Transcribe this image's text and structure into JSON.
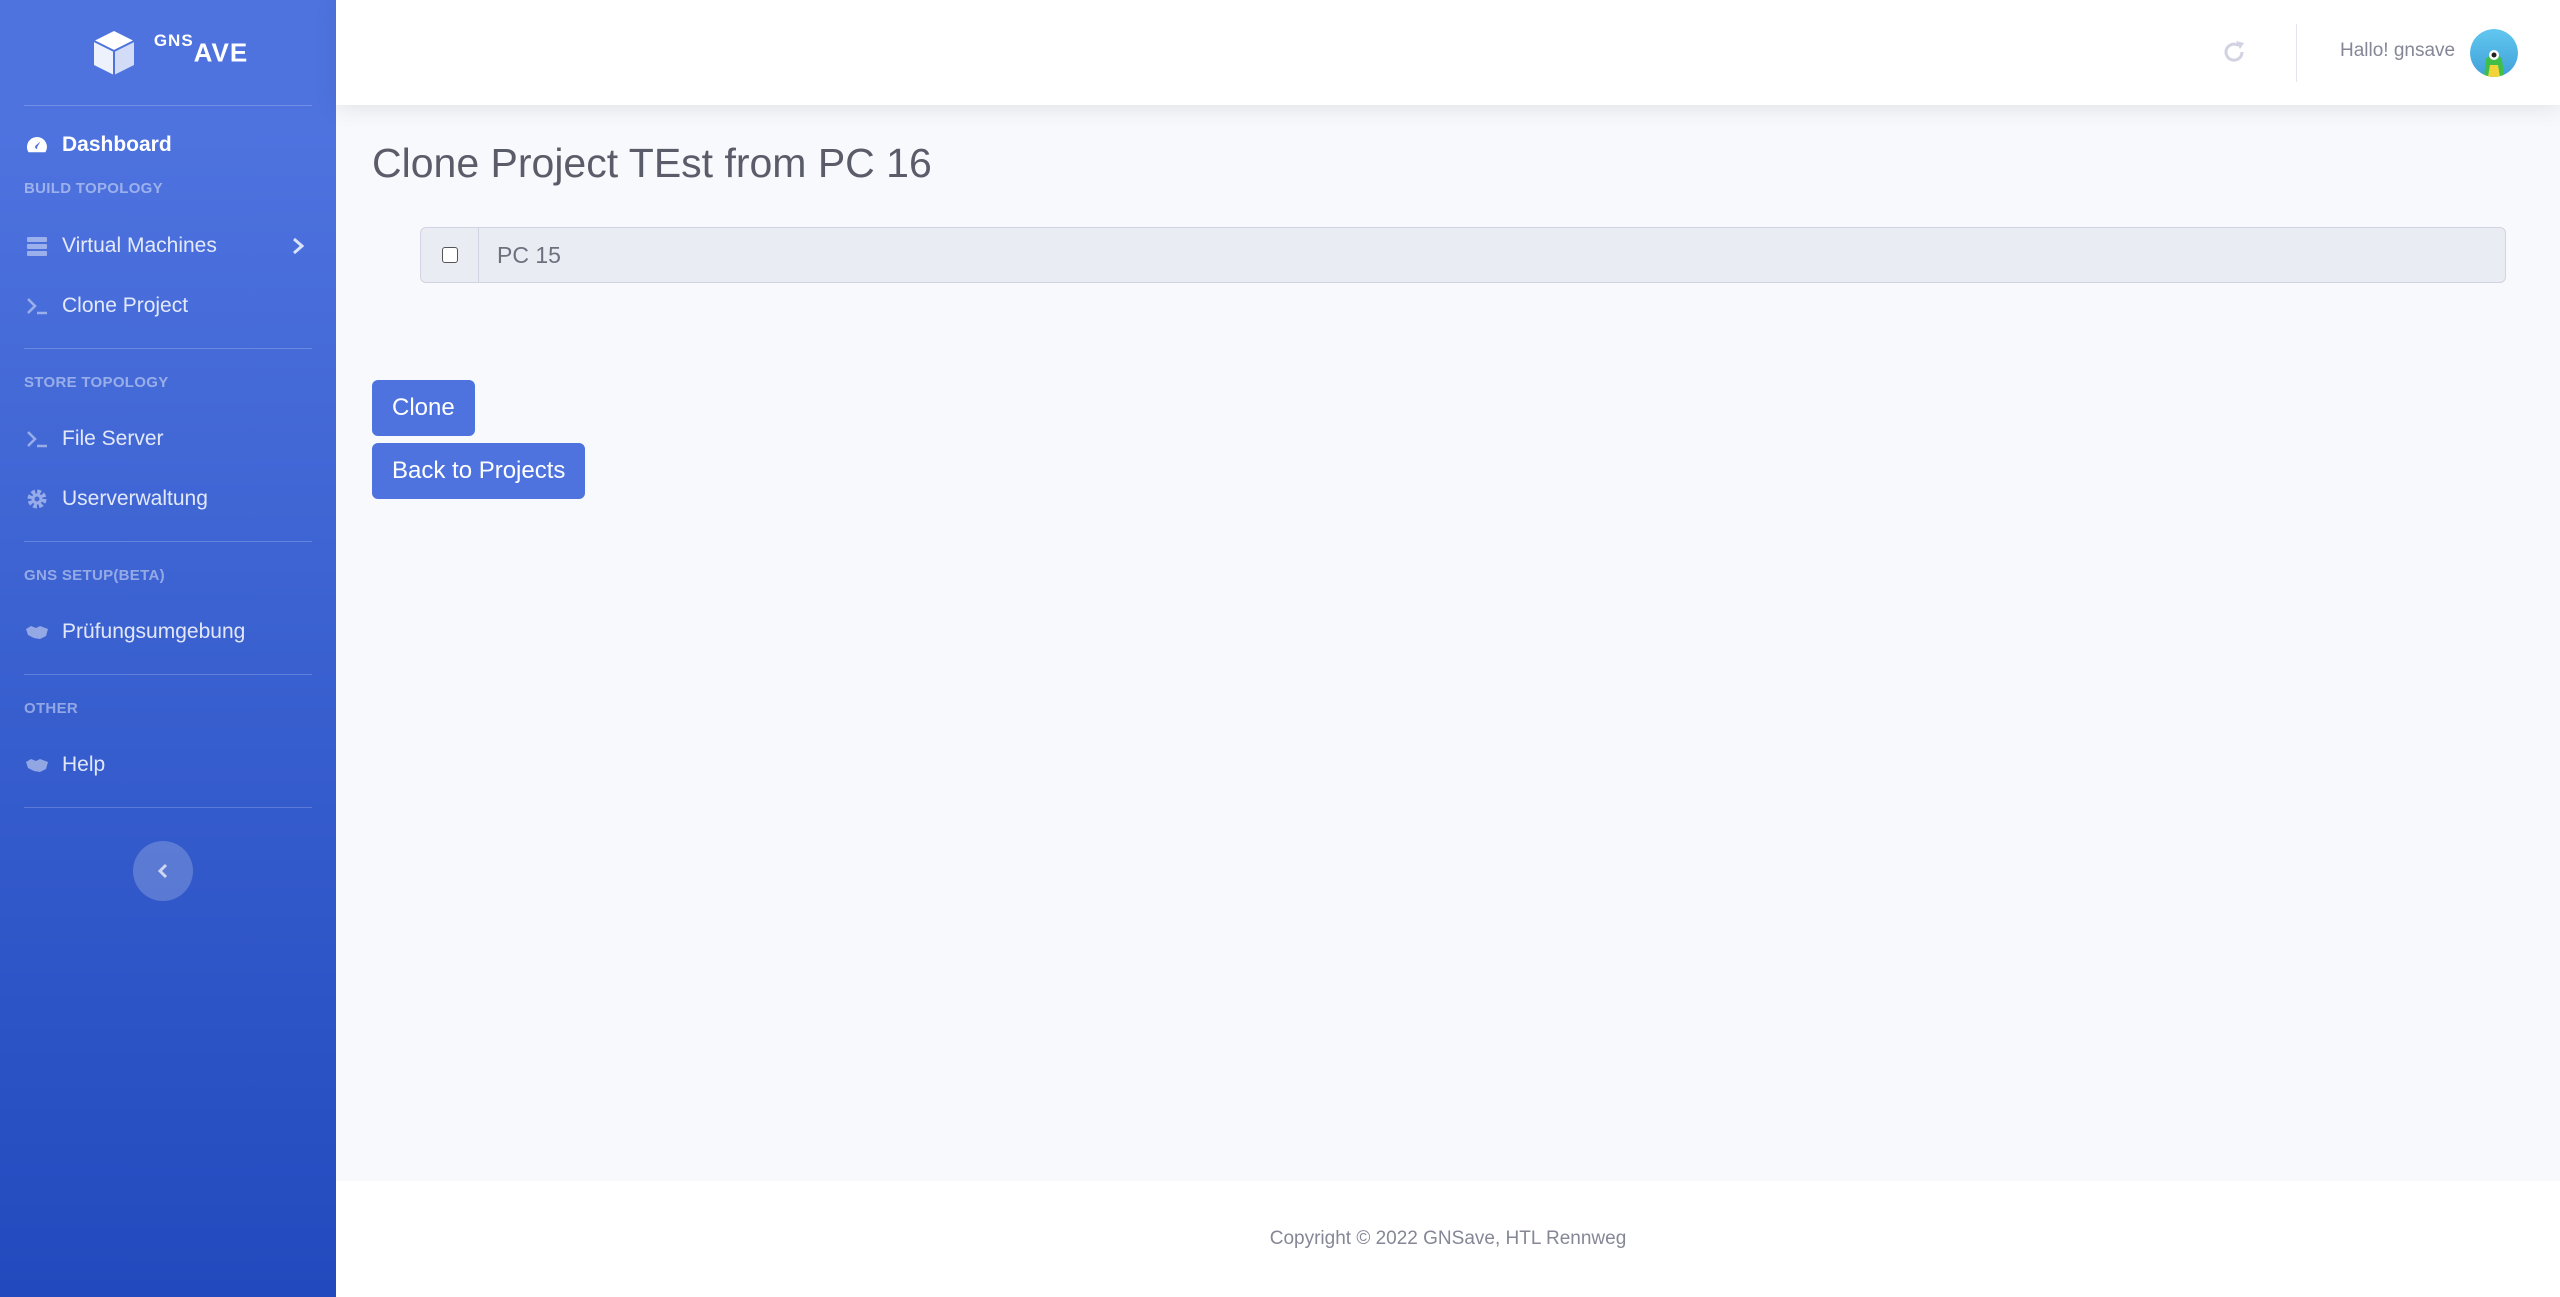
{
  "brand": {
    "prefix": "GNS",
    "suffix": "AVE"
  },
  "sidebar": {
    "dashboard": "Dashboard",
    "headings": [
      "Build Topology",
      "Store Topology",
      "GNS Setup(Beta)",
      "Other"
    ],
    "items": [
      {
        "label": "Virtual Machines",
        "icon": "server-icon"
      },
      {
        "label": "Clone Project",
        "icon": "terminal-icon"
      },
      {
        "label": "File Server",
        "icon": "terminal-icon"
      },
      {
        "label": "Userverwaltung",
        "icon": "gear-icon"
      },
      {
        "label": "Prüfungsumgebung",
        "icon": "handshake-icon"
      },
      {
        "label": "Help",
        "icon": "handshake-icon"
      }
    ]
  },
  "topbar": {
    "greeting": "Hallo! gnsave"
  },
  "main": {
    "title": "Clone Project TEst from PC 16",
    "option_label": "PC 15",
    "clone_button": "Clone",
    "back_button": "Back to Projects"
  },
  "footer": {
    "copyright": "Copyright © 2022 GNSave, HTL Rennweg"
  },
  "colors": {
    "primary": "#4e73df",
    "primary_dark": "#224abe"
  }
}
